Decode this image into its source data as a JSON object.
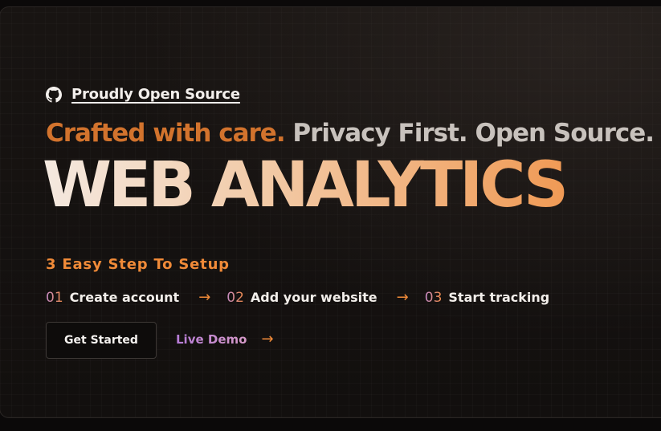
{
  "badge": {
    "icon": "github-icon",
    "label": "Proudly Open Source"
  },
  "tagline": {
    "accent": "Crafted with care.",
    "rest": " Privacy First. Open Source."
  },
  "hero": {
    "title": "WEB ANALYTICS"
  },
  "steps": {
    "heading": "3 Easy Step To Setup",
    "items": [
      {
        "num": "01",
        "label": "Create account"
      },
      {
        "num": "02",
        "label": "Add your website"
      },
      {
        "num": "03",
        "label": "Start tracking"
      }
    ],
    "arrow": "→"
  },
  "actions": {
    "primary_label": "Get Started",
    "demo_label": "Live Demo",
    "demo_arrow": "→"
  },
  "colors": {
    "accent": "#d2732d",
    "hero_gradient_start": "#f4e9e0",
    "hero_gradient_end": "#f09a55",
    "demo_link": "#b57bd6",
    "background": "#0b0909"
  }
}
